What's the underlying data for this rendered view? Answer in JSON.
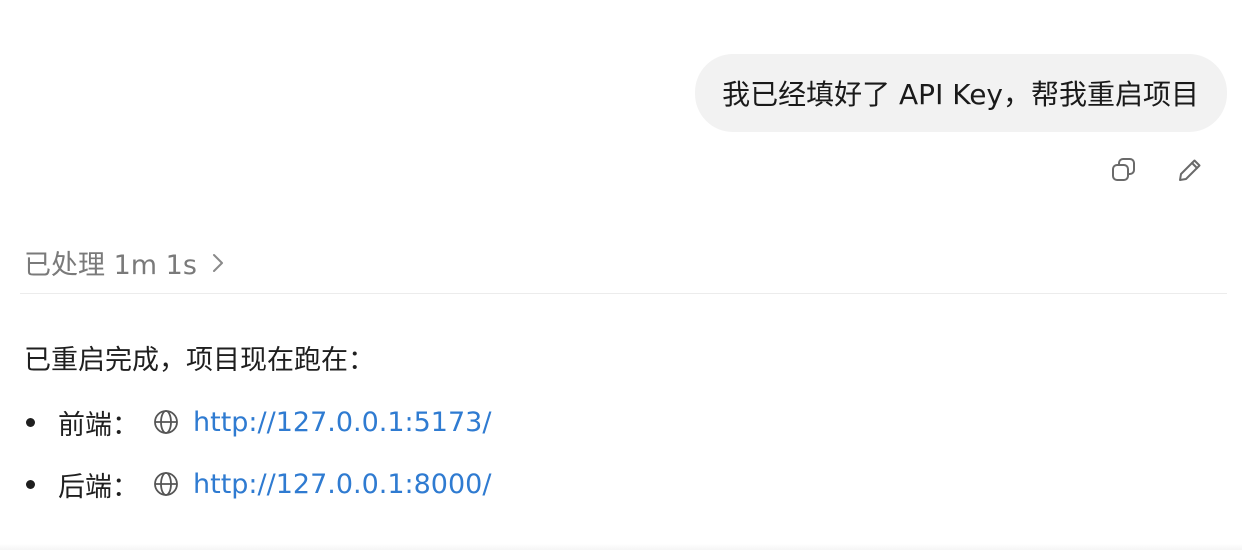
{
  "user_message": {
    "text": "我已经填好了 API Key，帮我重启项目"
  },
  "message_actions": {
    "copy_icon": "copy-icon",
    "edit_icon": "pencil-icon"
  },
  "processing": {
    "label": "已处理 1m 1s",
    "chevron_icon": "chevron-right-icon"
  },
  "reply": {
    "intro": "已重启完成，项目现在跑在：",
    "items": [
      {
        "label": "前端：",
        "icon": "globe-icon",
        "url": "http://127.0.0.1:5173/"
      },
      {
        "label": "后端：",
        "icon": "globe-icon",
        "url": "http://127.0.0.1:8000/"
      }
    ]
  },
  "colors": {
    "bubble_bg": "#f2f2f2",
    "link": "#2f7bd1",
    "muted_text": "#7a7a7a"
  }
}
